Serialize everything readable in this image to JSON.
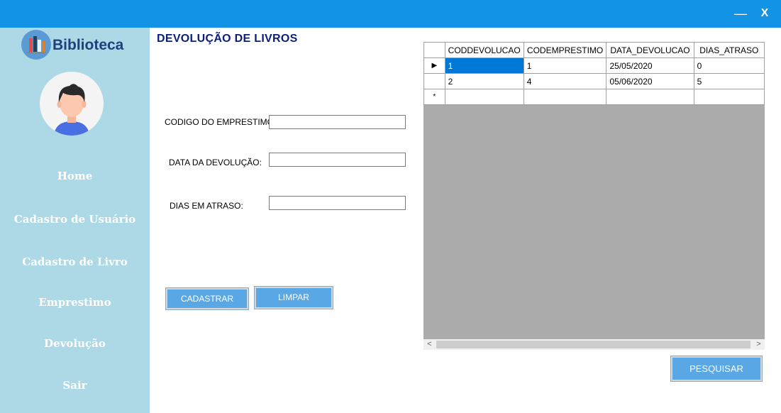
{
  "window": {
    "minimize_label": "—",
    "close_label": "X"
  },
  "sidebar": {
    "brand": "Biblioteca",
    "items": [
      {
        "label": "Home"
      },
      {
        "label": "Cadastro de Usuário"
      },
      {
        "label": "Cadastro de Livro"
      },
      {
        "label": "Emprestimo"
      },
      {
        "label": "Devolução"
      },
      {
        "label": "Sair"
      }
    ]
  },
  "page": {
    "title": "DEVOLUÇÃO DE LIVROS"
  },
  "form": {
    "codigo_label": "CODIGO DO EMPRESTIMO:",
    "codigo_value": "",
    "data_label": "DATA DA DEVOLUÇÃO:",
    "data_value": "",
    "dias_label": "DIAS EM ATRASO:",
    "dias_value": ""
  },
  "buttons": {
    "cadastrar": "CADASTRAR",
    "limpar": "LIMPAR",
    "pesquisar": "PESQUISAR"
  },
  "grid": {
    "columns": [
      "CODDEVOLUCAO",
      "CODEMPRESTIMO",
      "DATA_DEVOLUCAO",
      "DIAS_ATRASO"
    ],
    "rows": [
      {
        "marker": "▶",
        "cells": [
          "1",
          "1",
          "25/05/2020",
          "0"
        ]
      },
      {
        "marker": "",
        "cells": [
          "2",
          "4",
          "05/06/2020",
          "5"
        ]
      },
      {
        "marker": "*",
        "cells": [
          "",
          "",
          "",
          ""
        ]
      }
    ],
    "scroll_left": "<",
    "scroll_right": ">"
  },
  "colors": {
    "titlebar": "#1393e6",
    "sidebar": "#add8e6",
    "button": "#5aa7e6",
    "title": "#0a1f7a"
  }
}
